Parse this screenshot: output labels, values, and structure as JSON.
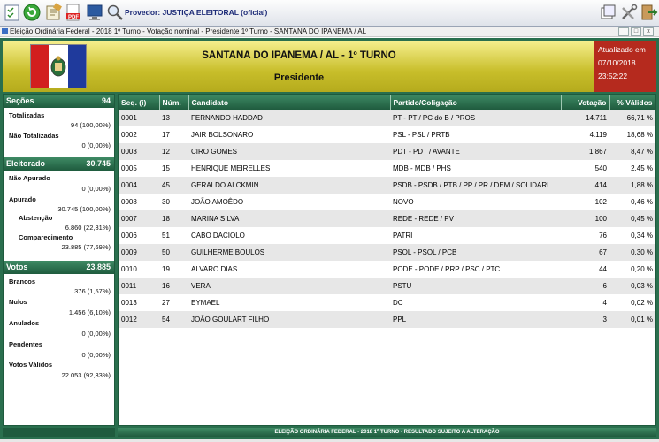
{
  "toolbar": {
    "provider_label": "Provedor: JUSTIÇA ELEITORAL (oficial)"
  },
  "window": {
    "title": "Eleição Ordinária Federal - 2018 1º Turno - Votação nominal - Presidente 1º Turno - SANTANA DO IPANEMA / AL",
    "minimize": "_",
    "maximize": "□",
    "close": "x"
  },
  "header": {
    "place": "SANTANA DO IPANEMA / AL - 1º TURNO",
    "office": "Presidente",
    "updated_label": "Atualizado em",
    "updated_date": "07/10/2018",
    "updated_time": "23:52:22"
  },
  "colors": {
    "frame": "#2a6f4e",
    "header_yellow": "#c8be2a",
    "updated_red": "#b52a1e"
  },
  "left": {
    "secoes": {
      "title": "Seções",
      "value": "94",
      "totalizadas_label": "Totalizadas",
      "totalizadas_value": "94 (100,00%)",
      "nao_totalizadas_label": "Não Totalizadas",
      "nao_totalizadas_value": "0 (0,00%)"
    },
    "eleitorado": {
      "title": "Eleitorado",
      "value": "30.745",
      "nao_apurado_label": "Não Apurado",
      "nao_apurado_value": "0 (0,00%)",
      "apurado_label": "Apurado",
      "apurado_value": "30.745 (100,00%)",
      "abstencao_label": "Abstenção",
      "abstencao_value": "6.860 (22,31%)",
      "comparecimento_label": "Comparecimento",
      "comparecimento_value": "23.885 (77,69%)"
    },
    "votos": {
      "title": "Votos",
      "value": "23.885",
      "brancos_label": "Brancos",
      "brancos_value": "376 (1,57%)",
      "nulos_label": "Nulos",
      "nulos_value": "1.456 (6,10%)",
      "anulados_label": "Anulados",
      "anulados_value": "0 (0,00%)",
      "pendentes_label": "Pendentes",
      "pendentes_value": "0 (0,00%)",
      "validos_label": "Votos Válidos",
      "validos_value": "22.053 (92,33%)"
    }
  },
  "table": {
    "headers": [
      "Seq.  (i)",
      "Núm.",
      "Candidato",
      "Partido/Coligação",
      "Votação",
      "% Válidos"
    ],
    "rows": [
      [
        "0001",
        "13",
        "FERNANDO HADDAD",
        "PT - PT / PC do B / PROS",
        "14.711",
        "66,71 %"
      ],
      [
        "0002",
        "17",
        "JAIR BOLSONARO",
        "PSL - PSL / PRTB",
        "4.119",
        "18,68 %"
      ],
      [
        "0003",
        "12",
        "CIRO GOMES",
        "PDT - PDT / AVANTE",
        "1.867",
        "8,47 %"
      ],
      [
        "0005",
        "15",
        "HENRIQUE MEIRELLES",
        "MDB - MDB / PHS",
        "540",
        "2,45 %"
      ],
      [
        "0004",
        "45",
        "GERALDO ALCKMIN",
        "PSDB - PSDB / PTB / PP / PR / DEM / SOLIDARIEDADE ...",
        "414",
        "1,88 %"
      ],
      [
        "0008",
        "30",
        "JOÃO AMOÊDO",
        "NOVO",
        "102",
        "0,46 %"
      ],
      [
        "0007",
        "18",
        "MARINA SILVA",
        "REDE - REDE / PV",
        "100",
        "0,45 %"
      ],
      [
        "0006",
        "51",
        "CABO DACIOLO",
        "PATRI",
        "76",
        "0,34 %"
      ],
      [
        "0009",
        "50",
        "GUILHERME BOULOS",
        "PSOL - PSOL / PCB",
        "67",
        "0,30 %"
      ],
      [
        "0010",
        "19",
        "ALVARO DIAS",
        "PODE - PODE / PRP / PSC / PTC",
        "44",
        "0,20 %"
      ],
      [
        "0011",
        "16",
        "VERA",
        "PSTU",
        "6",
        "0,03 %"
      ],
      [
        "0013",
        "27",
        "EYMAEL",
        "DC",
        "4",
        "0,02 %"
      ],
      [
        "0012",
        "54",
        "JOÃO GOULART FILHO",
        "PPL",
        "3",
        "0,01 %"
      ]
    ]
  },
  "footer": {
    "text": "ELEIÇÃO ORDINÁRIA FEDERAL - 2018 1º TURNO - RESULTADO SUJEITO A ALTERAÇÃO"
  }
}
